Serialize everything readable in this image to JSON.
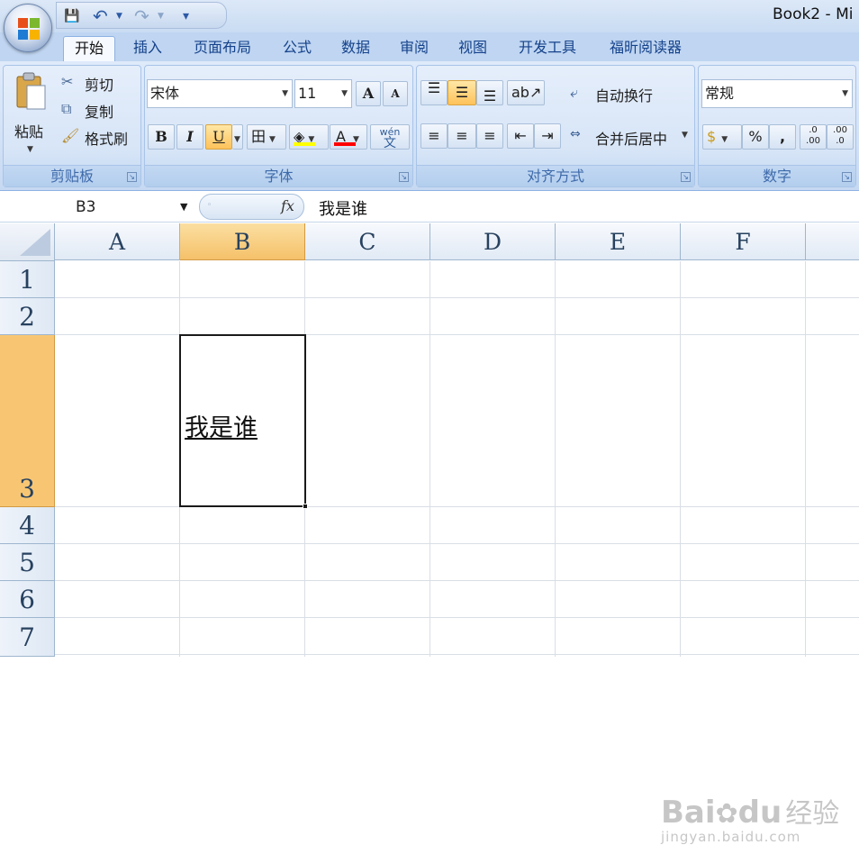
{
  "window": {
    "title": "Book2 - Mi"
  },
  "qat": {
    "save": "💾",
    "undo": "↶",
    "redo": "↷",
    "more": "▾"
  },
  "tabs": [
    "开始",
    "插入",
    "页面布局",
    "公式",
    "数据",
    "审阅",
    "视图",
    "开发工具",
    "福昕阅读器"
  ],
  "clipboard": {
    "paste": "粘贴",
    "cut": "剪切",
    "copy": "复制",
    "format_painter": "格式刷",
    "label": "剪贴板"
  },
  "font": {
    "name": "宋体",
    "size": "11",
    "grow": "A",
    "shrink": "A",
    "bold": "B",
    "italic": "I",
    "underline": "U",
    "border": "田",
    "fill_color": "#ffff00",
    "font_color": "#ff0000",
    "font_color_letter": "A",
    "phonetic": "wén",
    "label": "字体"
  },
  "alignment": {
    "wrap_text": "自动换行",
    "merge_center": "合并后居中",
    "label": "对齐方式"
  },
  "number": {
    "format": "常规",
    "percent": "%",
    "comma": ",",
    "inc_decimal": ".0 .00",
    "dec_decimal": ".00 .0",
    "label": "数字"
  },
  "formula_bar": {
    "name_box": "B3",
    "fx": "fx",
    "content": "我是谁"
  },
  "sheet": {
    "columns": [
      "A",
      "B",
      "C",
      "D",
      "E",
      "F"
    ],
    "selected_column": "B",
    "rows": [
      "1",
      "2",
      "3",
      "4",
      "5",
      "6",
      "7"
    ],
    "selected_row": "3",
    "cells": {
      "B3": "我是谁"
    }
  },
  "watermark": {
    "brand": "Bai",
    "brand2": "du",
    "cn": "经验",
    "url": "jingyan.baidu.com"
  }
}
